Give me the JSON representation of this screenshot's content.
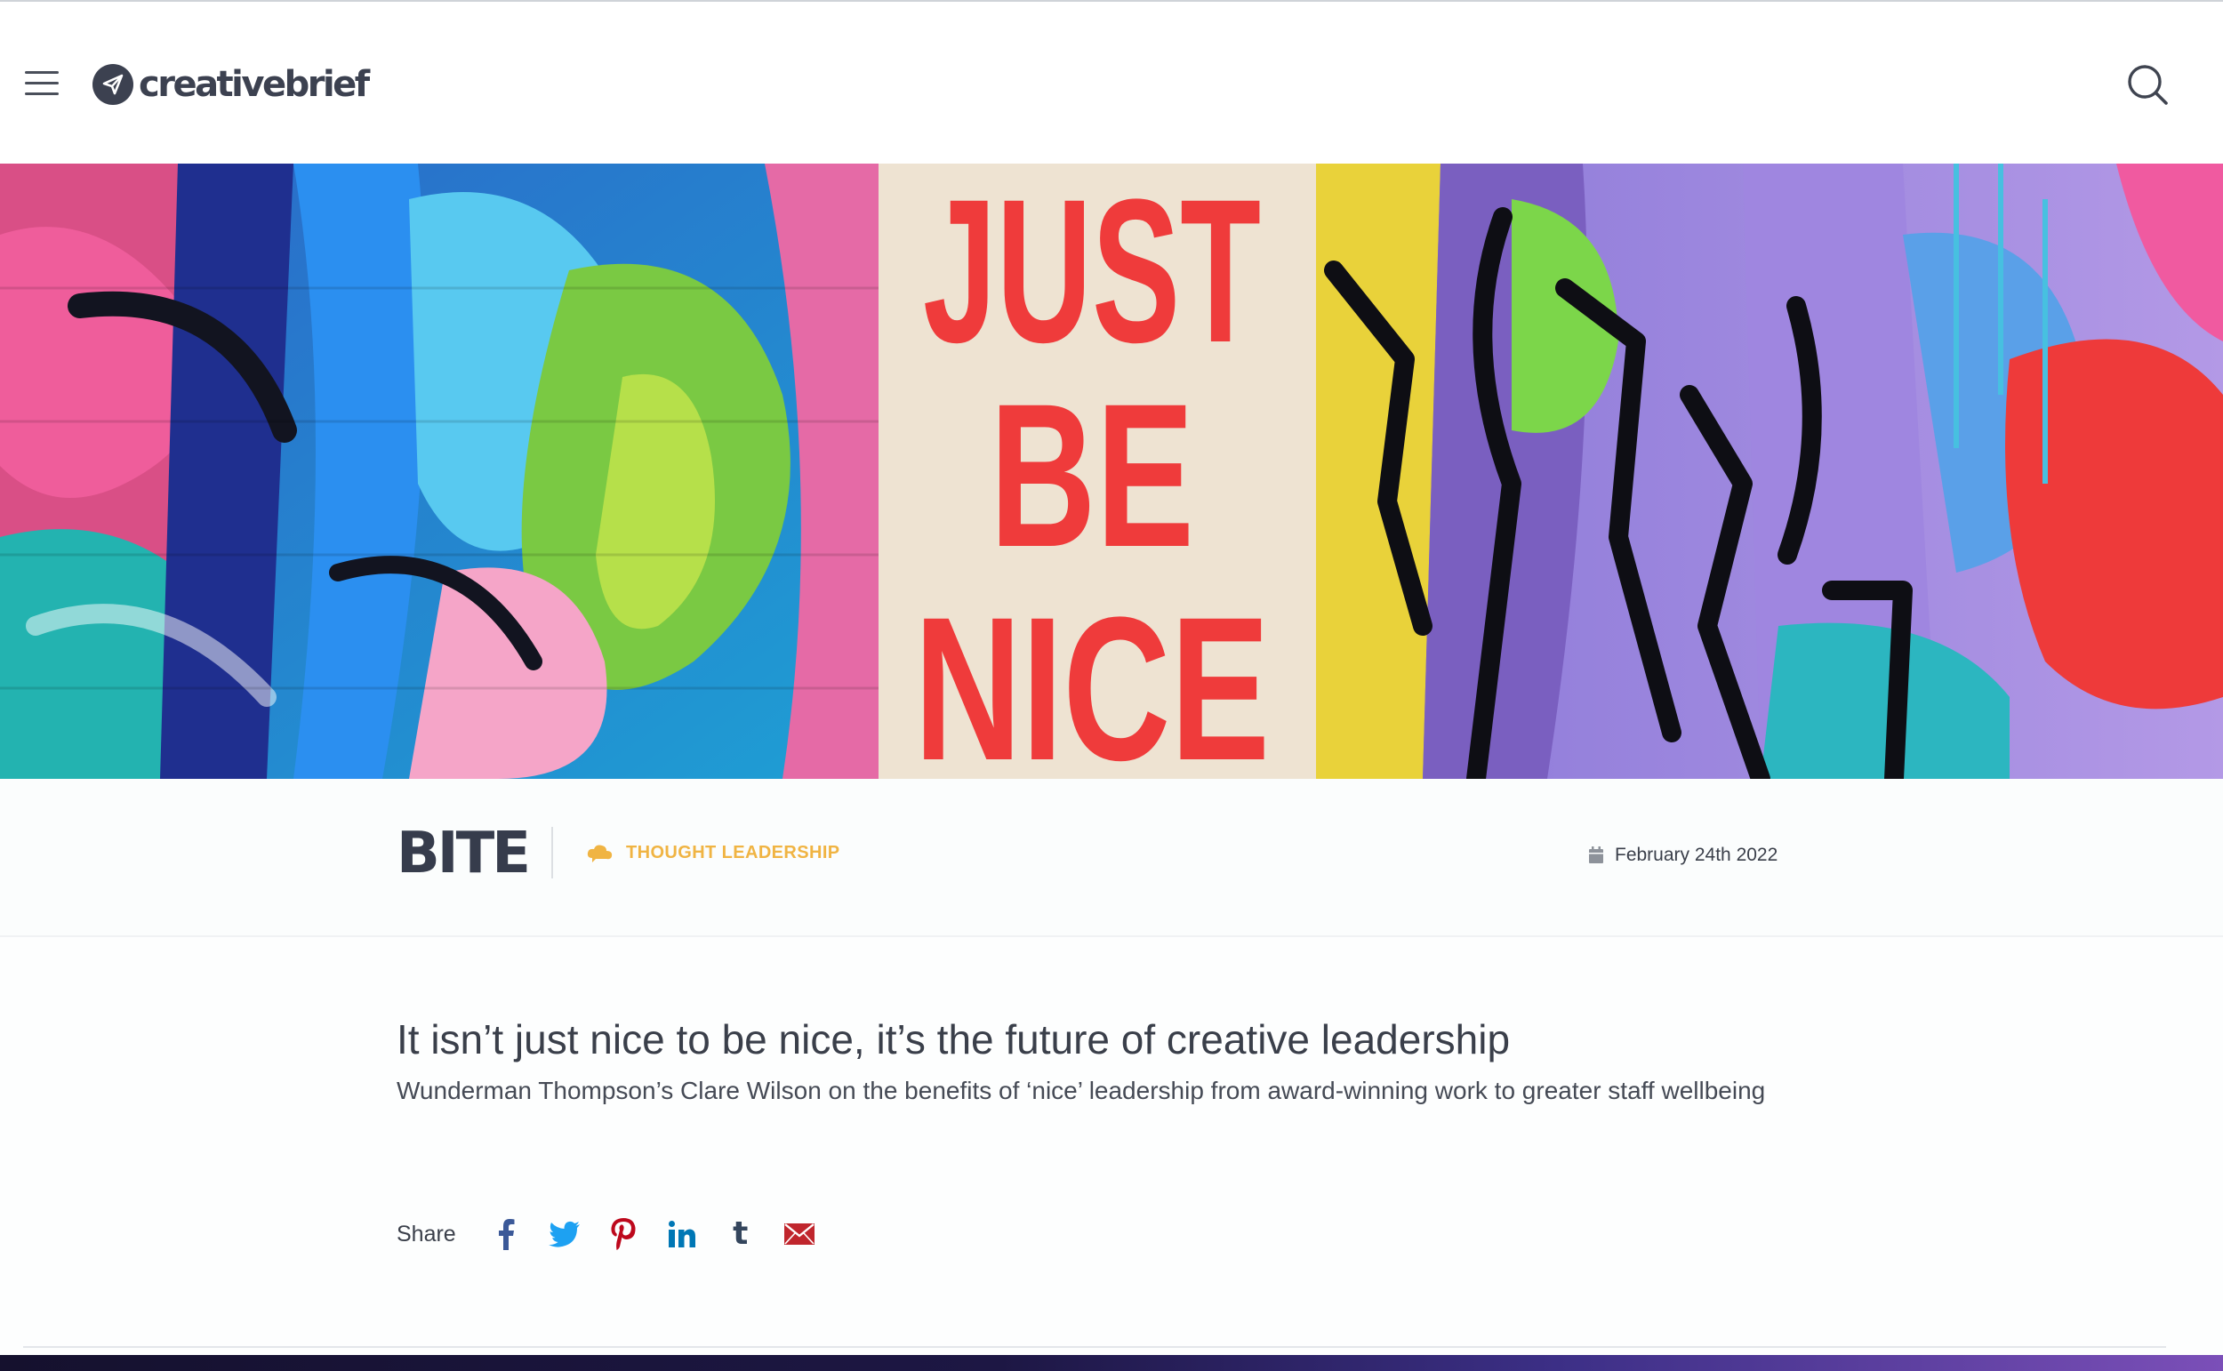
{
  "header": {
    "menu_icon": "hamburger-menu-icon",
    "logo_text": "creativebrief",
    "logo_icon": "paper-plane-icon",
    "search_icon": "search-icon"
  },
  "hero": {
    "poster_lines": [
      "JUST",
      "BE",
      "NICE"
    ]
  },
  "meta": {
    "brand": "BITE",
    "category": "THOUGHT LEADERSHIP",
    "category_icon": "speech-cloud-icon",
    "date_icon": "calendar-icon",
    "date": "February 24th 2022"
  },
  "article": {
    "title": "It isn’t just nice to be nice, it’s the future of creative leadership",
    "subtitle": "Wunderman Thompson’s Clare Wilson on the benefits of ‘nice’ leadership from award-winning work to greater staff wellbeing"
  },
  "share": {
    "label": "Share",
    "buttons": [
      {
        "name": "facebook",
        "icon": "facebook-icon",
        "color": "#3b5998"
      },
      {
        "name": "twitter",
        "icon": "twitter-icon",
        "color": "#1da1f2"
      },
      {
        "name": "pinterest",
        "icon": "pinterest-icon",
        "color": "#bd081c"
      },
      {
        "name": "linkedin",
        "icon": "linkedin-icon",
        "color": "#0077b5"
      },
      {
        "name": "tumblr",
        "icon": "tumblr-icon",
        "color": "#34465d",
        "glyph": "t"
      },
      {
        "name": "email",
        "icon": "email-icon",
        "color": "#c0262d"
      }
    ]
  },
  "colors": {
    "accent": "#f0b443",
    "text": "#3a3f4a",
    "poster_red": "#ef3b3b"
  }
}
